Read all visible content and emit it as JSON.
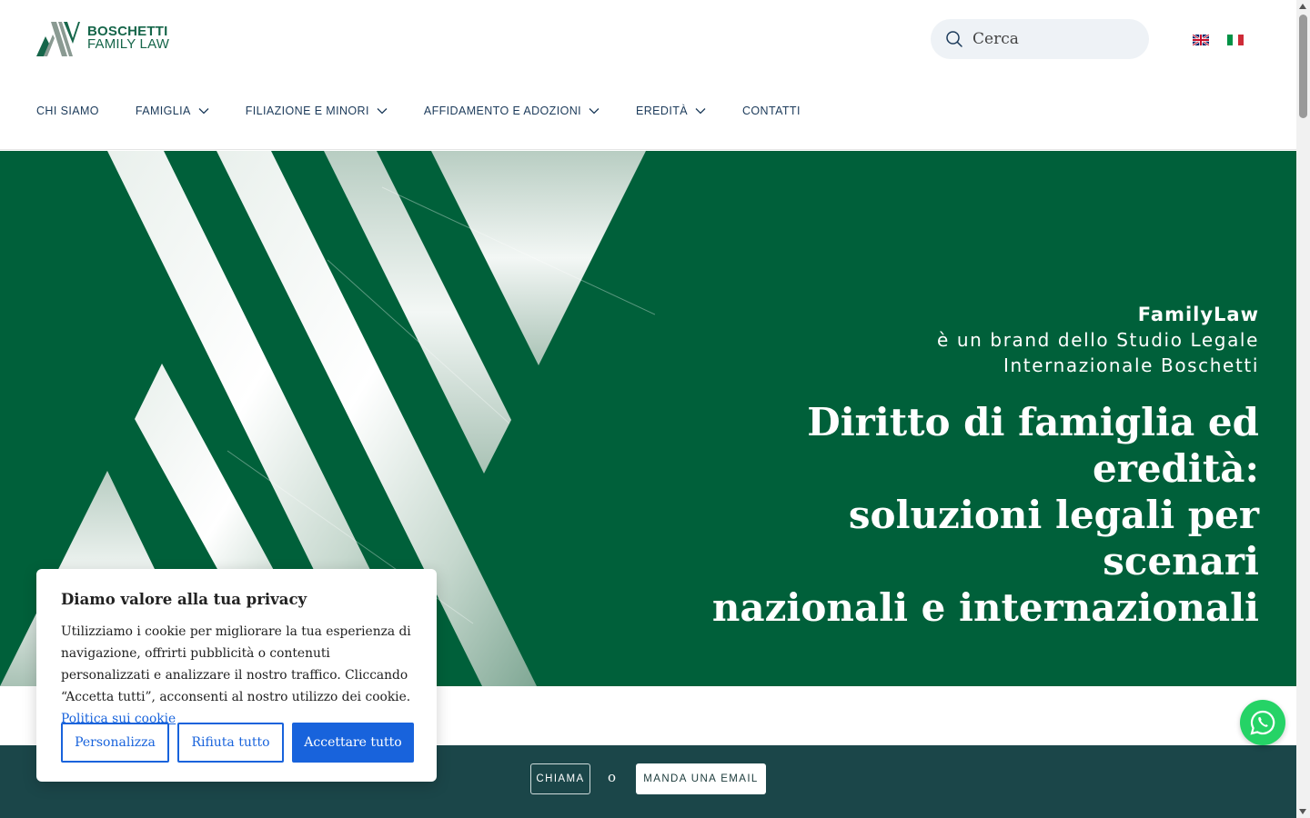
{
  "header": {
    "logo": {
      "line1": "BOSCHETTI",
      "line2": "FAMILY LAW"
    },
    "search": {
      "placeholder": "Cerca"
    },
    "languages": [
      {
        "code": "en",
        "icon": "uk-flag-icon"
      },
      {
        "code": "it",
        "icon": "italy-flag-icon"
      }
    ]
  },
  "nav": {
    "items": [
      {
        "label": "CHI SIAMO",
        "dropdown": false
      },
      {
        "label": "FAMIGLIA",
        "dropdown": true
      },
      {
        "label": "FILIAZIONE E MINORI",
        "dropdown": true
      },
      {
        "label": "AFFIDAMENTO E ADOZIONI",
        "dropdown": true
      },
      {
        "label": "EREDITÀ",
        "dropdown": true
      },
      {
        "label": "CONTATTI",
        "dropdown": false
      }
    ]
  },
  "hero": {
    "brand_title": "FamilyLaw",
    "brand_sub_line1": "è un brand dello Studio Legale",
    "brand_sub_line2": "Internazionale Boschetti",
    "headline_line1": "Diritto di famiglia ed eredità:",
    "headline_line2": "soluzioni legali per scenari",
    "headline_line3": "nazionali e internazionali"
  },
  "cta": {
    "call_label": "CHIAMA",
    "or_label": "o",
    "email_label": "MANDA UNA EMAIL"
  },
  "cookie": {
    "title": "Diamo valore alla tua privacy",
    "text": "Utilizziamo i cookie per migliorare la tua esperienza di navigazione, offrirti pubblicità o contenuti personalizzati e analizzare il nostro traffico. Cliccando “Accetta tutti”, acconsenti al nostro utilizzo dei cookie.",
    "link_label": "Politica sui cookie",
    "buttons": {
      "customize": "Personalizza",
      "reject": "Rifiuta tutto",
      "accept": "Accettare tutto"
    }
  },
  "colors": {
    "brand_green": "#00603a",
    "cta_bar": "#1b4649",
    "cookie_blue": "#1863dc",
    "whatsapp": "#25d366"
  }
}
